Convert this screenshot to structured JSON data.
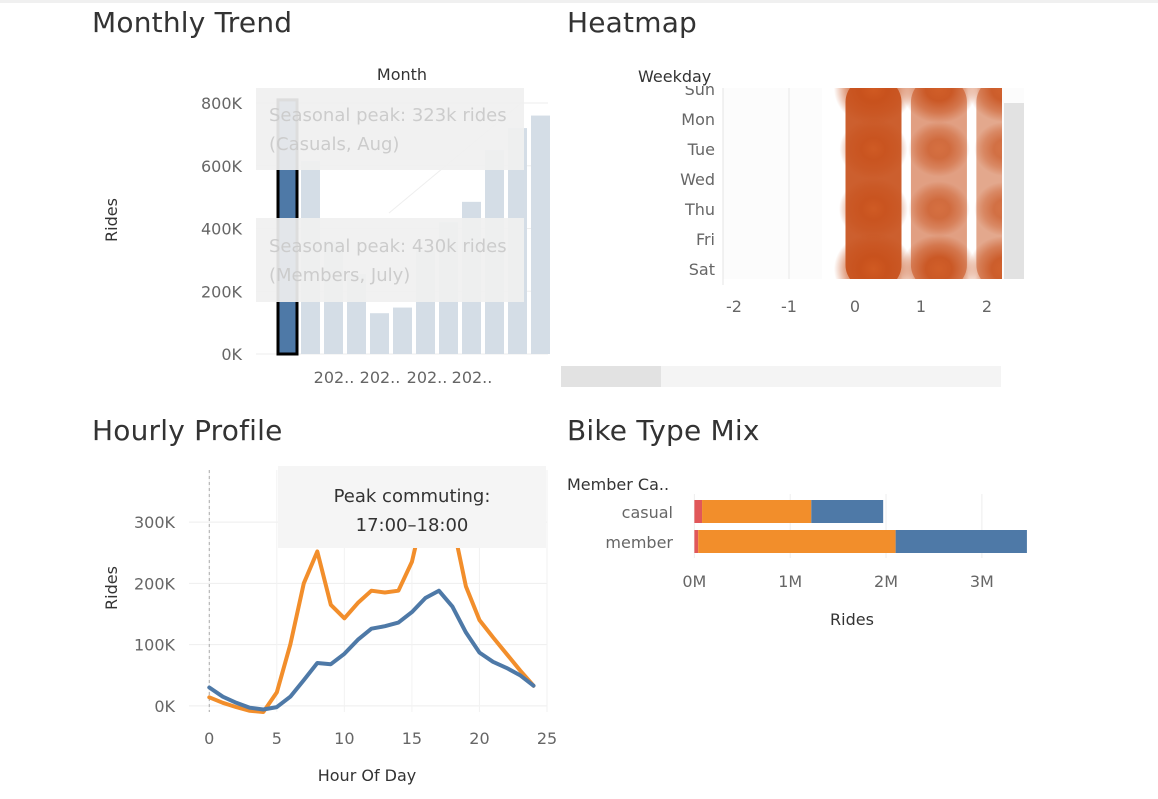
{
  "panels": {
    "monthly_title": "Monthly Trend",
    "heatmap_title": "Heatmap",
    "hourly_title": "Hourly Profile",
    "biketype_title": "Bike Type Mix"
  },
  "colors": {
    "bar_fill": "#d4dde6",
    "bar_highlight": "#4e79a7",
    "member": "#4e79a7",
    "casual": "#f28e2b",
    "classic": "#f28e2b",
    "docked": "#e15759",
    "electric": "#4e79a7",
    "heat_high": "#c8511c",
    "heat_low": "#ffffff"
  },
  "tooltips": {
    "casual_peak": [
      "Seasonal peak: 323k rides",
      "(Casuals, Aug)"
    ],
    "member_peak": [
      "Seasonal peak: 430k rides",
      "(Members, July)"
    ],
    "commute_peak": [
      "Peak commuting:",
      "17:00–18:00"
    ]
  },
  "chart_data": [
    {
      "id": "monthly",
      "type": "bar",
      "column_header": "Month",
      "ylabel": "Rides",
      "ylim": [
        0,
        800000
      ],
      "y_ticks": [
        0,
        200000,
        400000,
        600000,
        800000
      ],
      "y_tick_labels": [
        "0K",
        "200K",
        "400K",
        "600K",
        "800K"
      ],
      "x_tick_labels": [
        "202..",
        "202..",
        "202..",
        "202.."
      ],
      "values": [
        810000,
        615000,
        360000,
        255000,
        130000,
        148000,
        330000,
        420000,
        485000,
        650000,
        720000,
        760000
      ],
      "highlight_index": 0
    },
    {
      "id": "heatmap",
      "type": "heatmap",
      "ylabel": "Weekday",
      "y_categories": [
        "Sun",
        "Mon",
        "Tue",
        "Wed",
        "Thu",
        "Fri",
        "Sat"
      ],
      "x_ticks": [
        -2,
        -1,
        0,
        1,
        2
      ],
      "x_range": [
        -2.3,
        2.3
      ],
      "hotspots": [
        {
          "x": 0,
          "day": 0,
          "w": 1.0
        },
        {
          "x": 1,
          "day": 0,
          "w": 0.85
        },
        {
          "x": 2,
          "day": 0,
          "w": 0.75
        },
        {
          "x": 0,
          "day": 2,
          "w": 0.55
        },
        {
          "x": 1,
          "day": 2,
          "w": 0.3
        },
        {
          "x": 2,
          "day": 2,
          "w": 0.25
        },
        {
          "x": 0,
          "day": 4,
          "w": 0.6
        },
        {
          "x": 1,
          "day": 4,
          "w": 0.3
        },
        {
          "x": 2,
          "day": 4,
          "w": 0.25
        },
        {
          "x": 0,
          "day": 6,
          "w": 1.0
        },
        {
          "x": 1,
          "day": 6,
          "w": 0.85
        },
        {
          "x": 2,
          "day": 6,
          "w": 0.75
        }
      ]
    },
    {
      "id": "hourly",
      "type": "line",
      "xlabel": "Hour Of Day",
      "ylabel": "Rides",
      "xlim": [
        -1.5,
        25
      ],
      "ylim": [
        -10000,
        385000
      ],
      "x_ticks": [
        0,
        5,
        10,
        15,
        20,
        25
      ],
      "y_ticks": [
        0,
        100000,
        200000,
        300000
      ],
      "y_tick_labels": [
        "0K",
        "100K",
        "200K",
        "300K"
      ],
      "x": [
        0,
        1,
        2,
        3,
        4,
        5,
        6,
        7,
        8,
        9,
        10,
        11,
        12,
        13,
        14,
        15,
        16,
        17,
        18,
        19,
        20,
        21,
        22,
        23,
        24
      ],
      "series": [
        {
          "key": "casual",
          "values": [
            14000,
            5000,
            -2000,
            -8000,
            -10000,
            22000,
            100000,
            200000,
            252000,
            165000,
            143000,
            168000,
            188000,
            185000,
            188000,
            235000,
            330000,
            370000,
            300000,
            195000,
            140000,
            112000,
            85000,
            58000,
            33000
          ]
        },
        {
          "key": "member",
          "values": [
            30000,
            15000,
            5000,
            -3000,
            -6000,
            -2000,
            15000,
            42000,
            70000,
            68000,
            85000,
            108000,
            126000,
            130000,
            136000,
            153000,
            176000,
            188000,
            162000,
            120000,
            87000,
            72000,
            62000,
            50000,
            33000
          ]
        }
      ]
    },
    {
      "id": "biketype",
      "type": "bar",
      "orientation": "horizontal",
      "stacked": true,
      "column_header": "Member Ca..",
      "xlabel": "Rides",
      "xlim": [
        -0.15,
        3.45
      ],
      "x_ticks": [
        0,
        1,
        2,
        3
      ],
      "x_tick_labels": [
        "0M",
        "1M",
        "2M",
        "3M"
      ],
      "categories": [
        "casual",
        "member"
      ],
      "series": [
        {
          "key": "docked",
          "values": [
            0.08,
            0.04
          ]
        },
        {
          "key": "classic",
          "values": [
            1.14,
            2.06
          ]
        },
        {
          "key": "electric",
          "values": [
            0.75,
            1.37
          ]
        }
      ]
    }
  ]
}
